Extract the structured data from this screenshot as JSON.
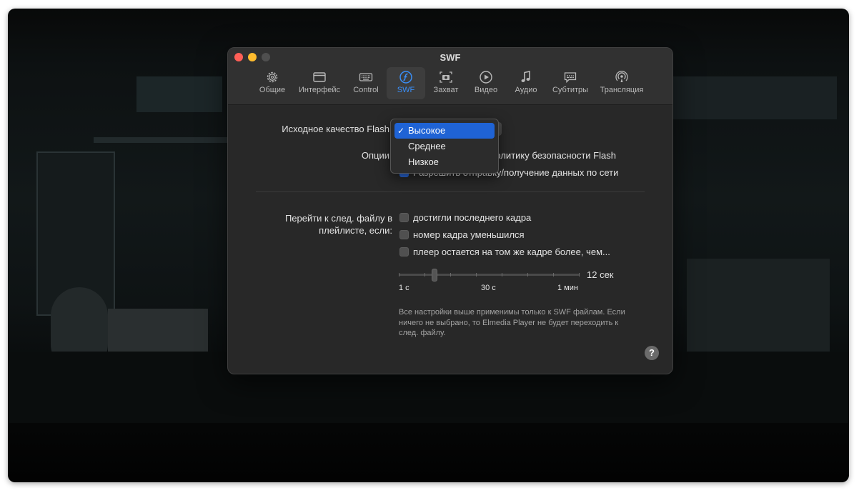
{
  "window": {
    "title": "SWF"
  },
  "tabs": [
    {
      "label": "Общие",
      "icon": "gear-icon"
    },
    {
      "label": "Интерфейс",
      "icon": "window-icon"
    },
    {
      "label": "Control",
      "icon": "keyboard-icon"
    },
    {
      "label": "SWF",
      "icon": "flash-icon",
      "active": true
    },
    {
      "label": "Захват",
      "icon": "camera-icon"
    },
    {
      "label": "Видео",
      "icon": "play-icon"
    },
    {
      "label": "Аудио",
      "icon": "music-note-icon"
    },
    {
      "label": "Субтитры",
      "icon": "subtitles-icon"
    },
    {
      "label": "Трансляция",
      "icon": "broadcast-icon"
    }
  ],
  "quality": {
    "label": "Исходное качество Flash",
    "menu": {
      "options": [
        "Высокое",
        "Среднее",
        "Низкое"
      ],
      "selected": "Высокое"
    }
  },
  "options": {
    "label": "Опции",
    "items": [
      {
        "label": "ю политику безопасности Flash",
        "checked": true
      },
      {
        "label": "Разрешить отправку/получение данных по сети",
        "checked": true
      }
    ]
  },
  "next_file": {
    "label_line1": "Перейти к след. файлу в",
    "label_line2": "плейлисте, если:",
    "conditions": [
      {
        "label": "достигли последнего кадра",
        "checked": false
      },
      {
        "label": "номер кадра уменьшился",
        "checked": false
      },
      {
        "label": "плеер остается на том же кадре более, чем...",
        "checked": false
      }
    ],
    "slider": {
      "value_label": "12 сек",
      "value_fraction": 0.2,
      "min_label": "1 с",
      "mid_label": "30 с",
      "max_label": "1 мин"
    },
    "note": "Все настройки выше применимы только к SWF файлам. Если ничего не выбрано, то Elmedia Player не будет переходить к след. файлу."
  },
  "help": {
    "label": "?"
  },
  "colors": {
    "accent": "#3a8ff8",
    "menu_selected": "#1f63d5",
    "close": "#fe5f57",
    "minimize": "#febc2e"
  }
}
